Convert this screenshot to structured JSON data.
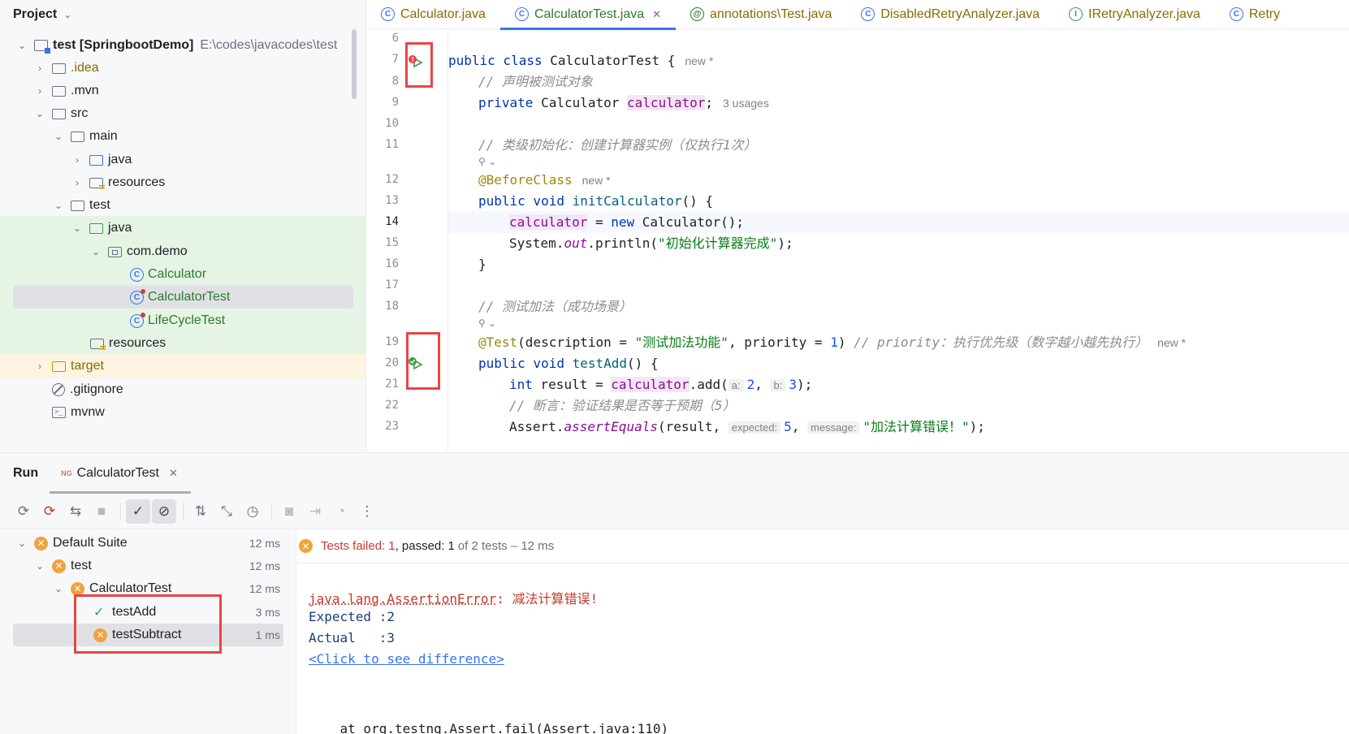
{
  "project": {
    "title": "Project",
    "items": [
      {
        "label": "test [SpringbootDemo]",
        "extra": "E:\\codes\\javacodes\\test"
      },
      {
        "label": ".idea"
      },
      {
        "label": ".mvn"
      },
      {
        "label": "src"
      },
      {
        "label": "main"
      },
      {
        "label": "java"
      },
      {
        "label": "resources"
      },
      {
        "label": "test"
      },
      {
        "label": "java"
      },
      {
        "label": "com.demo"
      },
      {
        "label": "Calculator"
      },
      {
        "label": "CalculatorTest"
      },
      {
        "label": "LifeCycleTest"
      },
      {
        "label": "resources"
      },
      {
        "label": "target"
      },
      {
        "label": ".gitignore"
      },
      {
        "label": "mvnw"
      }
    ]
  },
  "editor": {
    "tabs": [
      "Calculator.java",
      "CalculatorTest.java",
      "annotations\\Test.java",
      "DisabledRetryAnalyzer.java",
      "IRetryAnalyzer.java",
      "Retry"
    ],
    "active_tab": "CalculatorTest.java",
    "line_numbers": [
      "6",
      "7",
      "8",
      "9",
      "10",
      "11",
      "12",
      "13",
      "14",
      "15",
      "16",
      "17",
      "18",
      "19",
      "20",
      "21",
      "22",
      "23"
    ],
    "hints": {
      "new": "new *",
      "usages": "3 usages",
      "a": "a:",
      "b": "b:",
      "expected": "expected:",
      "message": "message:"
    },
    "code": {
      "class_decl_kw": "public class",
      "class_name": " CalculatorTest {",
      "comment_declare": "// 声明被测试对象",
      "private_kw": "private",
      "calc_type": " Calculator ",
      "calc_field": "calculator",
      "semicolon": ";",
      "comment_init": "// 类级初始化：创建计算器实例（仅执行1次）",
      "before_class": "@BeforeClass",
      "public_void": "public void",
      "init_method": " initCalculator",
      "parens_brace": "() {",
      "assign": " = ",
      "new_kw": "new",
      "new_calc": " Calculator();",
      "system": "System.",
      "out": "out",
      "println_open": ".println(",
      "init_str": "\"初始化计算器完成\"",
      "close_paren": ");",
      "close_brace": "}",
      "comment_add": "// 测试加法（成功场景）",
      "test_anno": "@Test",
      "desc_open": "(description = ",
      "add_str": "\"测试加法功能\"",
      "priority_part": ", priority = ",
      "priority_val": "1",
      "priority_close": ")",
      "priority_comment": "// priority：执行优先级（数字越小越先执行）",
      "test_add_method": " testAdd",
      "int_kw": "int",
      "result_eq": " result = ",
      "add_call": ".add(",
      "two": "2",
      "comma": ", ",
      "three": "3",
      "comment_assert": "// 断言：验证结果是否等于预期（5）",
      "assert_start": "Assert.",
      "assert_method": "assertEquals",
      "assert_args": "(result, ",
      "five": "5",
      "err_str": "\"加法计算错误！\"",
      "lens": "⚲ ⌄"
    }
  },
  "run": {
    "title": "Run",
    "tab_label": "CalculatorTest",
    "ng_badge": "NG",
    "tree": [
      {
        "label": "Default Suite",
        "time": "12 ms",
        "status": "failed"
      },
      {
        "label": "test",
        "time": "12 ms",
        "status": "failed"
      },
      {
        "label": "CalculatorTest",
        "time": "12 ms",
        "status": "failed"
      },
      {
        "label": "testAdd",
        "time": "3 ms",
        "status": "passed"
      },
      {
        "label": "testSubtract",
        "time": "1 ms",
        "status": "failed"
      }
    ],
    "summary": {
      "failed_label": "Tests failed:",
      "failed_count": "1",
      "passed_label": ", passed:",
      "passed_count": "1",
      "rest": "of 2 tests – 12 ms"
    },
    "console": {
      "error_class": "java.lang.AssertionError",
      "error_msg": ": 减法计算错误!",
      "expected_line": "Expected :2",
      "actual_line": "Actual   :3",
      "diff_link": "<Click to see difference>",
      "trace_partial": "    at org.testng.Assert.fail(Assert.java:110)"
    }
  },
  "colors": {
    "accent": "#3574f0",
    "highlight_box": "#e84545",
    "fail": "#f2a23a",
    "pass": "#3c9b4a"
  }
}
